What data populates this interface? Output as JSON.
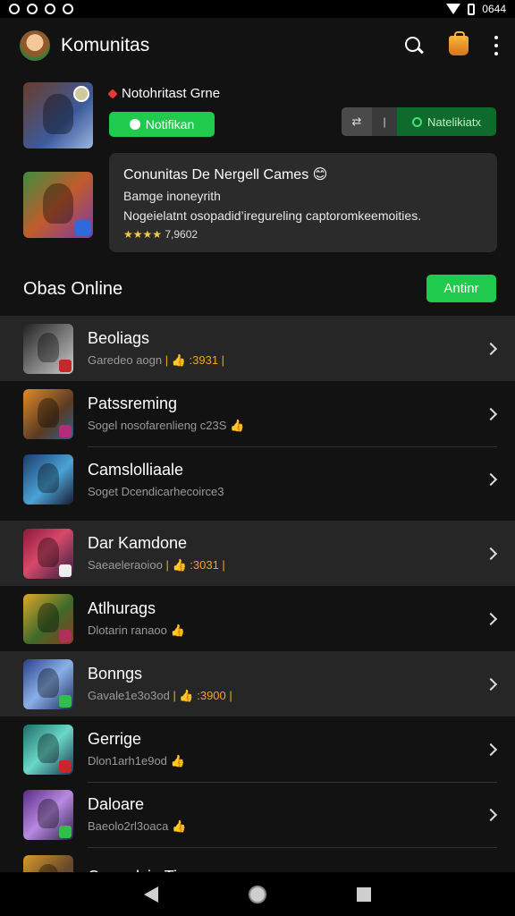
{
  "status_bar": {
    "time": "0644"
  },
  "header": {
    "title": "Komunitas"
  },
  "featured": {
    "notification_text": "Notohritast Grne",
    "notify_button": "Notifikan",
    "segment_label": "Natelikiatx",
    "segment_a": "⇄",
    "segment_b": "|"
  },
  "description": {
    "title": "Conunitas De Nergell Cames 😊",
    "subtitle": "Bamge inoneyrith",
    "body": "Nogeielatnt osopadid’iregureling captoromkeemoities.",
    "stars": "★★★★",
    "rating": "7,9602"
  },
  "section": {
    "title": "Obas Online",
    "action_label": "Antinr"
  },
  "games": [
    {
      "title": "Beoliags",
      "sub": "Garedeo aogn",
      "meta": "| 👍 :3931 |"
    },
    {
      "title": "Patssreming",
      "sub": "Sogel nosofarenlieng c23S",
      "meta": "👍"
    },
    {
      "title": "Camslolliaale",
      "sub": "Soget Dcendicarhecoirce3",
      "meta": ""
    },
    {
      "title": "Dar Kamdone",
      "sub": "Saeaeleraoioo",
      "meta": "| 👍 :3031 |"
    },
    {
      "title": "Atlhurags",
      "sub": "Dlotarin ranaoo",
      "meta": "👍"
    },
    {
      "title": "Bonngs",
      "sub": "Gavale1e3o3od",
      "meta": "| 👍 :3900 |"
    },
    {
      "title": "Gerrige",
      "sub": "Dlon1arh1e9od",
      "meta": "👍"
    },
    {
      "title": "Daloare",
      "sub": "Baeolo2rl3oaca",
      "meta": "👍"
    },
    {
      "title": "Camorlcio Ticarn",
      "sub": "",
      "meta": ""
    }
  ],
  "colors": {
    "accent_green": "#1fca4d",
    "background": "#121212",
    "card": "#2b2b2b"
  }
}
